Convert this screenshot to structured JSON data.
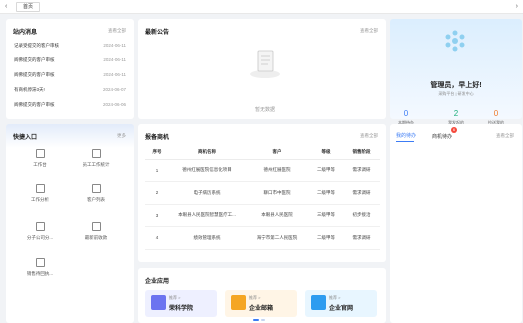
{
  "tabbar": {
    "left_arrow": "‹",
    "right_arrow": "›",
    "home_tab": "首页"
  },
  "messages": {
    "title": "站内消息",
    "more": "查看全部",
    "items": [
      {
        "text": "记录受提交的客户审核",
        "date": "2024-06-11"
      },
      {
        "text": "阅佛提交的客户审核",
        "date": "2024-06-11"
      },
      {
        "text": "阅佛提交的客户审核",
        "date": "2024-06-11"
      },
      {
        "text": "有商机停滞3天!",
        "date": "2024-06-07"
      },
      {
        "text": "阅佛提交的客户审核",
        "date": "2024-06-06"
      }
    ]
  },
  "announcements": {
    "title": "最新公告",
    "more": "查看全部",
    "empty_text": "暂无数据"
  },
  "greeting": {
    "title": "管理员，早上好!",
    "subtitle": "采购平台 | 研发中心",
    "stats": [
      {
        "value": "0",
        "label": "本期待办",
        "color": "#3c7cf5"
      },
      {
        "value": "2",
        "label": "我发起的",
        "color": "#1fb07c"
      },
      {
        "value": "0",
        "label": "抄送我的",
        "color": "#f07a2a"
      }
    ]
  },
  "quick_access": {
    "title": "快捷入口",
    "more": "更多",
    "items": [
      {
        "label": "工作台",
        "icon": "workbench-icon"
      },
      {
        "label": "员工工作统计",
        "icon": "employee-stats-icon"
      },
      {
        "label": "工作分析",
        "icon": "work-analysis-icon"
      },
      {
        "label": "客户列表",
        "icon": "customer-list-icon"
      },
      {
        "label": "分子公司分...",
        "icon": "subsidiary-icon"
      },
      {
        "label": "最新前收款",
        "icon": "payment-icon"
      },
      {
        "label": "销售待回执...",
        "icon": "sales-receipt-icon"
      }
    ]
  },
  "opportunities": {
    "title": "报备商机",
    "more": "查看全部",
    "columns": [
      "序号",
      "商机名称",
      "客户",
      "等级",
      "销售阶段"
    ],
    "rows": [
      [
        "1",
        "德州红展医院信息化项目",
        "德州红展医院",
        "二级甲等",
        "需求调研"
      ],
      [
        "2",
        "电子病历系统",
        "聊口市中医院",
        "二级甲等",
        "需求调研"
      ],
      [
        "3",
        "本眼县人民医院智慧医疗工...",
        "本眼县人民医院",
        "三级甲等",
        "初步接洽"
      ],
      [
        "4",
        "绩效管理系统",
        "海宁市第二人民医院",
        "二级甲等",
        "需求调研"
      ]
    ]
  },
  "todos": {
    "tab_mine": "我的待办",
    "tab_opp": "商机待办",
    "badge": "6",
    "more": "查看全部"
  },
  "apps": {
    "title": "企业应用",
    "items": [
      {
        "tag": "推荐 >",
        "name": "荣科学院",
        "bg": "#eef0ff",
        "icon_color": "#6c74f0"
      },
      {
        "tag": "推荐 >",
        "name": "企业邮箱",
        "bg": "#fff5e6",
        "icon_color": "#f5a623"
      },
      {
        "tag": "推荐 >",
        "name": "企业官网",
        "bg": "#e8f6ff",
        "icon_color": "#2d9cf0"
      }
    ]
  }
}
